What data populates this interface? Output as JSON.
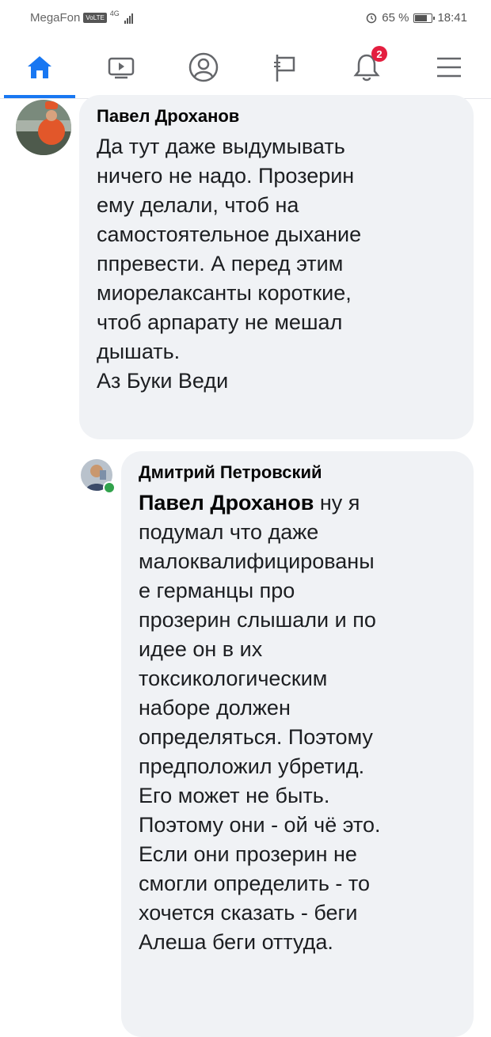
{
  "status_bar": {
    "carrier": "MegaFon",
    "volte": "VoLTE",
    "network": "4G",
    "battery": "65 %",
    "battery_level": 0.65,
    "time": "18:41"
  },
  "nav": {
    "notification_count": "2",
    "items": [
      "home-icon",
      "video-icon",
      "profile-icon",
      "pages-icon",
      "notifications-icon",
      "menu-icon"
    ],
    "accent_color": "#1877f2",
    "badge_color": "#e41e3f"
  },
  "comments": [
    {
      "author": "Павел Дроханов",
      "lines": [
        "Да тут даже выдумывать",
        "ничего не надо. Прозерин",
        "ему делали, чтоб на",
        "самостоятельное дыхание",
        "ппревести. А перед этим",
        "миорелаксанты короткие,",
        "чтоб арпарату не мешал",
        "дышать.",
        "Аз Буки Веди"
      ]
    },
    {
      "author": "Дмитрий Петровский",
      "mention": "Павел Дроханов",
      "first_line_rest": " ну я",
      "lines": [
        "подумал что даже",
        "малоквалифицированы",
        "е германцы про",
        "прозерин слышали и по",
        "идее он в их",
        "токсикологическим",
        "наборе должен",
        "определяться. Поэтому",
        "предположил убретид.",
        "Его может не быть.",
        "Поэтому они - ой чё это.",
        "Если они прозерин не",
        "смогли определить - то",
        "хочется сказать - беги",
        "Алеша беги оттуда."
      ]
    }
  ]
}
